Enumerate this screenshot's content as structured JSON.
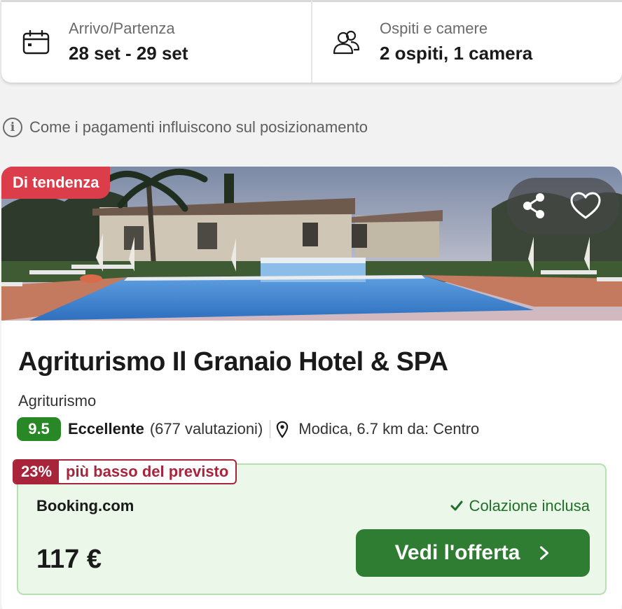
{
  "search": {
    "dates_label": "Arrivo/Partenza",
    "dates_value": "28 set - 29 set",
    "guests_label": "Ospiti e camere",
    "guests_value": "2 ospiti, 1 camera"
  },
  "info": {
    "text": "Come i pagamenti influiscono sul posizionamento"
  },
  "card": {
    "badge": "Di tendenza",
    "name": "Agriturismo Il Granaio Hotel & SPA",
    "type": "Agriturismo",
    "score": "9.5",
    "rating_word": "Eccellente",
    "reviews": "(677 valutazioni)",
    "location": "Modica, 6.7 km da: Centro",
    "deal_percent": "23%",
    "deal_text": "più basso del previsto",
    "provider": "Booking.com",
    "breakfast": "Colazione inclusa",
    "price": "117 €",
    "cta": "Vedi l'offerta"
  },
  "colors": {
    "brand_green": "#2e7d32",
    "score_green": "#288826",
    "trend_red": "#dc3d4b",
    "deal_red": "#a8243a",
    "offer_bg": "#eaf7e9"
  },
  "icons": [
    "calendar-icon",
    "users-icon",
    "info-icon",
    "share-icon",
    "heart-icon",
    "location-pin-icon",
    "check-icon",
    "chevron-right-icon"
  ]
}
